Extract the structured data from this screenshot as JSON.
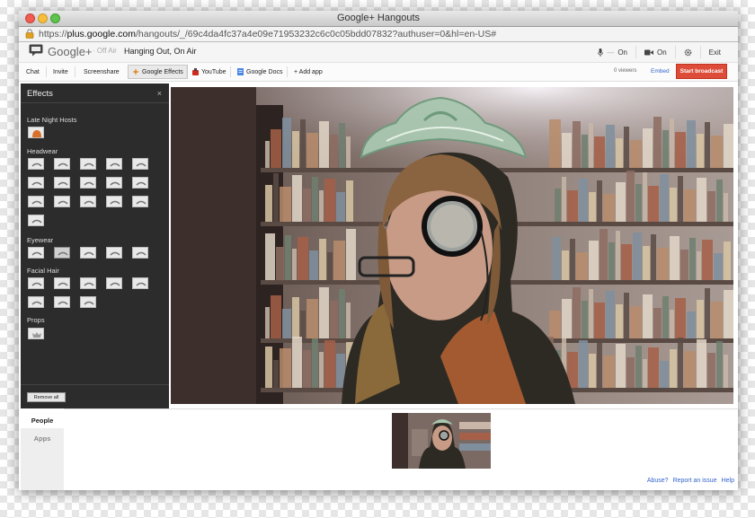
{
  "window": {
    "title": "Google+ Hangouts"
  },
  "address_bar": {
    "scheme": "https://",
    "host": "plus.google.com",
    "path": "/hangouts/_/69c4da4fc37a4e09e71953232c6c0c05bdd07832?authuser=0&hl=en-US#"
  },
  "header": {
    "brand": "Google+",
    "status": "· Off Air",
    "hangout_name": "Hanging Out, On Air",
    "mic_state": "On",
    "camera_state": "On",
    "exit_label": "Exit"
  },
  "toolbar": {
    "items": [
      "Chat",
      "Invite",
      "Screenshare",
      "Google Effects",
      "YouTube",
      "Google Docs",
      "+ Add app"
    ],
    "active_item": "Google Effects",
    "viewers": "0 viewers",
    "embed_label": "Embed",
    "broadcast_label": "Start broadcast",
    "broadcast_color": "#dd4b39"
  },
  "effects_panel": {
    "title": "Effects",
    "close_label": "×",
    "categories": [
      {
        "name": "Late Night Hosts",
        "count": 1
      },
      {
        "name": "Headwear",
        "count": 16
      },
      {
        "name": "Eyewear",
        "count": 5,
        "selected_index": 1
      },
      {
        "name": "Facial Hair",
        "count": 8
      },
      {
        "name": "Props",
        "count": 1
      }
    ],
    "remove_all_label": "Remove all"
  },
  "sidebar": {
    "tabs": [
      "People",
      "Apps"
    ],
    "active": "People"
  },
  "footer": {
    "links": [
      "Abuse?",
      "Report an issue",
      "Help"
    ]
  },
  "colors": {
    "link": "#3366cc",
    "panel_bg": "#2c2c2c",
    "accent_red": "#dd4b39"
  }
}
